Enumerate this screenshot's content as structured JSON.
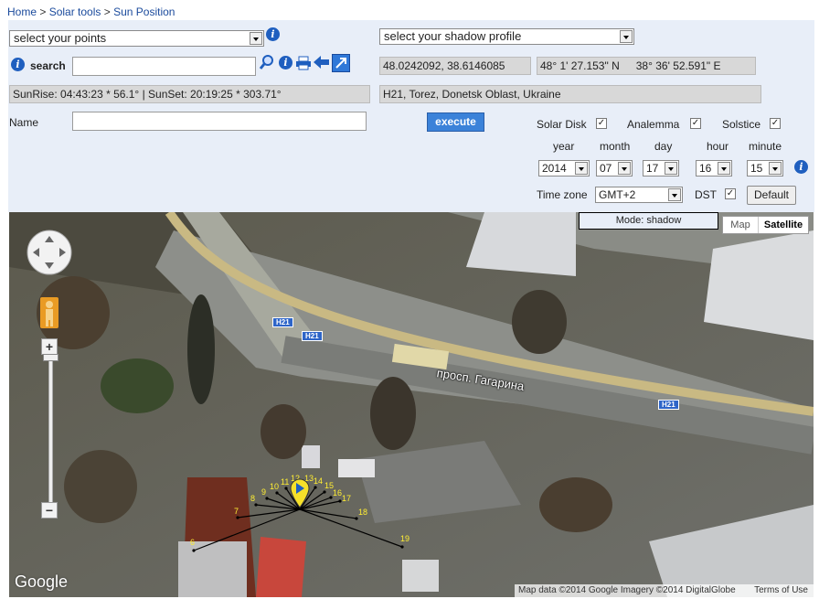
{
  "breadcrumb": {
    "home": "Home",
    "sep": " > ",
    "tools": "Solar tools",
    "current": "Sun Position"
  },
  "controls": {
    "points_select": "select your points",
    "shadow_select": "select your shadow profile",
    "search_label": "search",
    "search_value": "",
    "decimal_coords": "48.0242092, 38.6146085",
    "dms_lat": "48° 1' 27.153\" N",
    "dms_lon": "38° 36' 52.591\" E",
    "sun_times": "SunRise: 04:43:23 * 56.1° | SunSet: 20:19:25 * 303.71°",
    "address": "H21, Torez, Donetsk Oblast, Ukraine",
    "name_label": "Name",
    "name_value": "",
    "execute_label": "execute",
    "solar_disk_label": "Solar Disk",
    "analemma_label": "Analemma",
    "solstice_label": "Solstice",
    "year_label": "year",
    "month_label": "month",
    "day_label": "day",
    "hour_label": "hour",
    "minute_label": "minute",
    "year": "2014",
    "month": "07",
    "day": "17",
    "hour": "16",
    "minute": "15",
    "timezone_label": "Time zone",
    "timezone": "GMT+2",
    "dst_label": "DST",
    "default_label": "Default"
  },
  "map": {
    "mode": "Mode: shadow",
    "map_btn": "Map",
    "satellite_btn": "Satellite",
    "road_badge": "H21",
    "street_label": "просп. Гагарина",
    "attribution": "Map data ©2014 Google Imagery ©2014 DigitalGlobe",
    "terms": "Terms of Use",
    "logo": "Google",
    "hours": [
      "6",
      "7",
      "8",
      "9",
      "10",
      "11",
      "12",
      "13",
      "14",
      "15",
      "16",
      "17",
      "18",
      "19"
    ]
  },
  "colors": {
    "accent": "#3b82d9",
    "link": "#1a4a9c",
    "panel": "#e8eef8",
    "hour_label": "#ffee33"
  }
}
